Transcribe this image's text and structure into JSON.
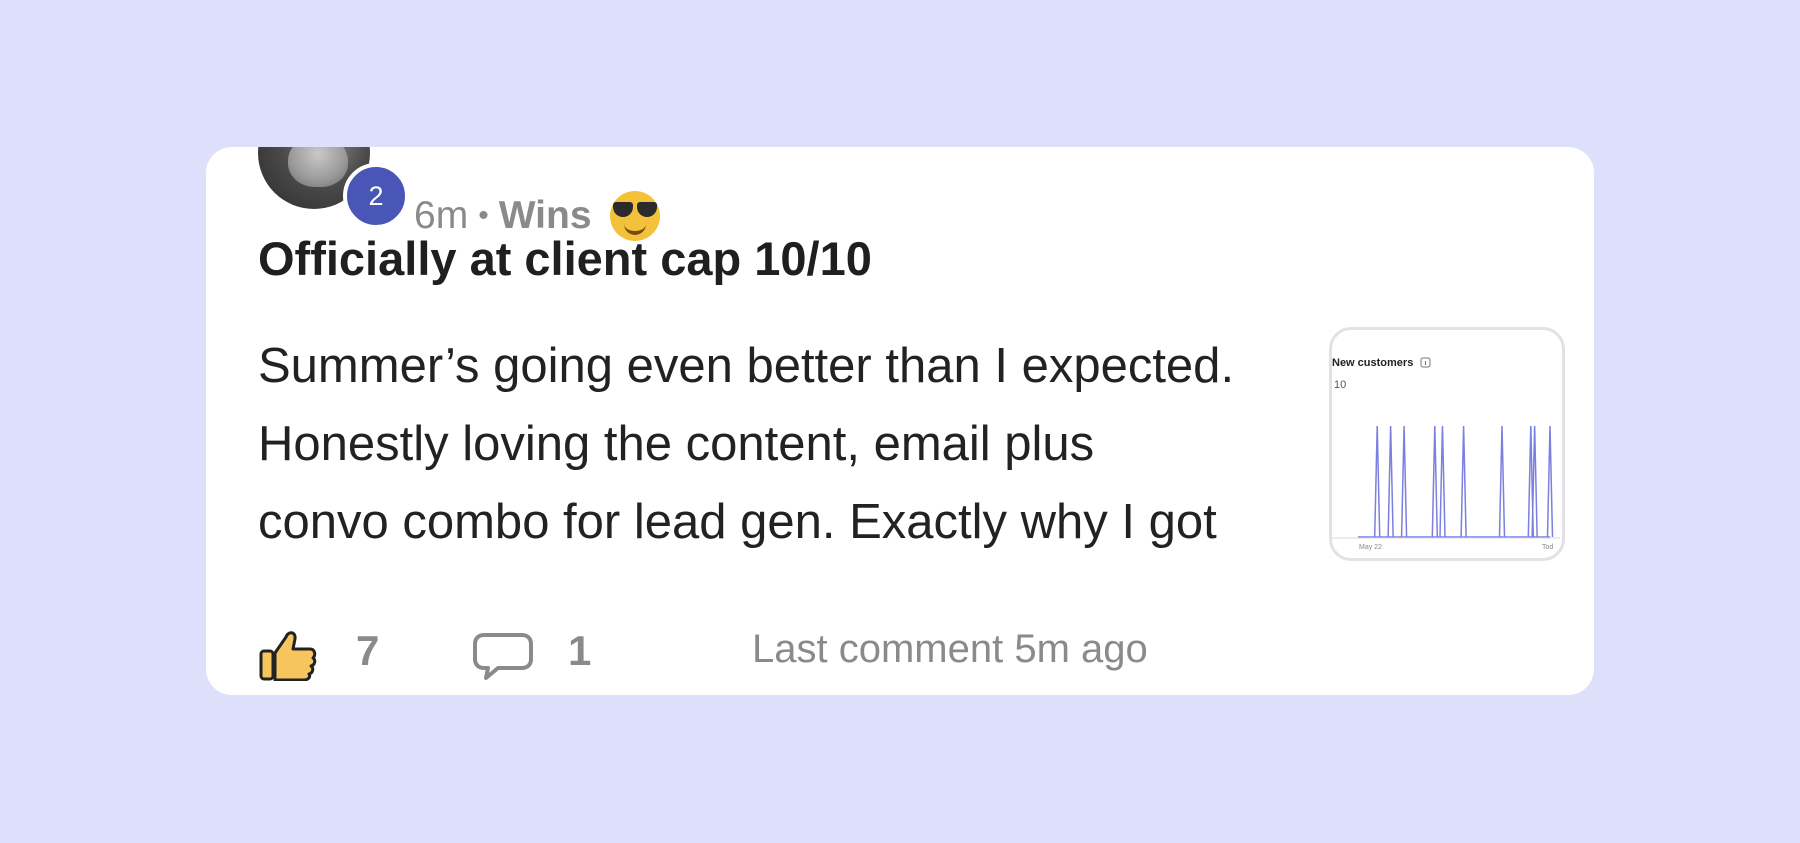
{
  "post": {
    "author_level": "2",
    "time_ago": "6m",
    "separator": "•",
    "category": "Wins",
    "category_emoji": "smiling-face-with-sunglasses-icon",
    "title": "Officially at client cap 10/10",
    "body_lines": [
      "Summer’s going even better than I expected.",
      "Honestly loving the content, email plus",
      "convo combo for lead gen. Exactly why I got"
    ]
  },
  "thumbnail": {
    "chart_data": {
      "type": "line",
      "title": "New customers",
      "y_tick_top": "10",
      "x_tick_labels": [
        "May 22",
        "Tod"
      ],
      "spike_positions": [
        0.1,
        0.17,
        0.24,
        0.4,
        0.44,
        0.55,
        0.75,
        0.9,
        0.92,
        1.0
      ],
      "spike_value": 10,
      "color": "#7b7fe0"
    }
  },
  "footer": {
    "likes": "7",
    "comments": "1",
    "last_comment": "Last comment 5m ago"
  },
  "colors": {
    "background": "#dedffa",
    "level_badge": "#4a55b8",
    "muted_text": "#8a8a8a",
    "like_icon": "#f7c55e"
  }
}
